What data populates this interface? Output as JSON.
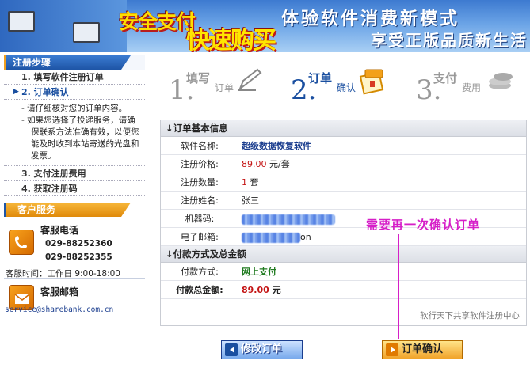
{
  "banner": {
    "slogan_safe": "安全支付",
    "slogan_fast": "快速购买",
    "headline1": "体验软件消费新模式",
    "headline2": "享受正版品质新生活"
  },
  "sidebar": {
    "title": "注册步骤",
    "steps": [
      {
        "label": "1. 填写软件注册订单"
      },
      {
        "label": "2. 订单确认"
      },
      {
        "label": "3. 支付注册费用"
      },
      {
        "label": "4. 获取注册码"
      }
    ],
    "substeps": [
      "- 请仔细核对您的订单内容。",
      "- 如果您选择了投递服务，请确保联系方法准确有效，以便您能及时收到本站寄送的光盘和发票。"
    ]
  },
  "service": {
    "title": "客户服务",
    "phone_title": "客服电话",
    "phone1": "029-88252360",
    "phone2": "029-88252355",
    "hours": "客服时间：工作日 9:00-18:00",
    "mail_title": "客服邮箱",
    "mail": "service@sharebank.com.cn"
  },
  "stepbar": [
    {
      "num": "1.",
      "t1": "填写",
      "t2": "订单"
    },
    {
      "num": "2.",
      "t1": "订单",
      "t2": "确认"
    },
    {
      "num": "3.",
      "t1": "支付",
      "t2": "费用"
    }
  ],
  "order": {
    "section1": "订单基本信息",
    "software_label": "软件名称:",
    "software_value": "超级数据恢复软件",
    "price_label": "注册价格:",
    "price_value": "89.00",
    "price_unit": " 元/套",
    "qty_label": "注册数量:",
    "qty_value": "1",
    "qty_unit": " 套",
    "name_label": "注册姓名:",
    "name_value": "张三",
    "machine_label": "机器码:",
    "email_label": "电子邮箱:",
    "email_suffix": "on",
    "section2": "付款方式及总金额",
    "pay_label": "付款方式:",
    "pay_value": "网上支付",
    "total_label": "付款总金额:",
    "total_value": "89.00",
    "total_unit": " 元",
    "footer": "软行天下共享软件注册中心"
  },
  "annotation": "需要再一次确认订单",
  "buttons": {
    "modify": "修改订单",
    "confirm": "订单确认"
  }
}
